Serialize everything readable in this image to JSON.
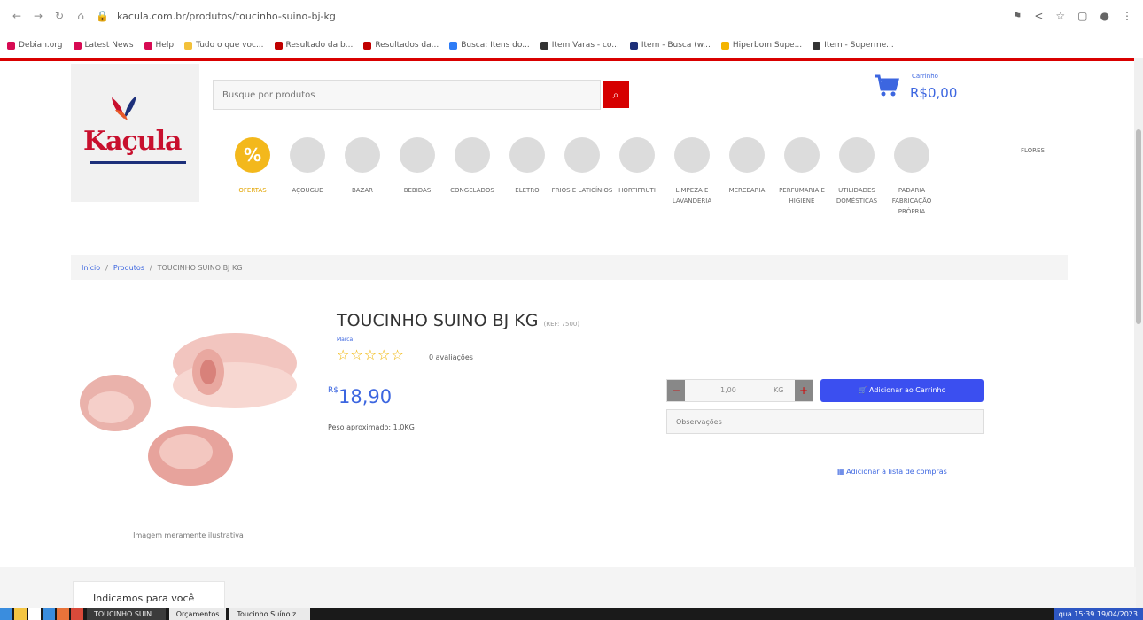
{
  "browser": {
    "url": "kacula.com.br/produtos/toucinho-suino-bj-kg",
    "bookmarks": [
      {
        "label": "Debian.org",
        "color": "#d70a53"
      },
      {
        "label": "Latest News",
        "color": "#d70a53"
      },
      {
        "label": "Help",
        "color": "#d70a53"
      },
      {
        "label": "Tudo o que voc...",
        "color": "#f3c13a"
      },
      {
        "label": "Resultado da b...",
        "color": "#c00000"
      },
      {
        "label": "Resultados da...",
        "color": "#c00000"
      },
      {
        "label": "Busca: Itens do...",
        "color": "#2e7cf6"
      },
      {
        "label": "Item Varas - co...",
        "color": "#333333"
      },
      {
        "label": "Item - Busca (w...",
        "color": "#1d2f78"
      },
      {
        "label": "Hiperbom Supe...",
        "color": "#f4b400"
      },
      {
        "label": "Item - Superme...",
        "color": "#333333"
      }
    ]
  },
  "header": {
    "logo_text": "Kaçula",
    "search_placeholder": "Busque por produtos",
    "cart_label": "Carrinho",
    "cart_value": "R$0,00"
  },
  "categories": [
    {
      "label": "OFERTAS"
    },
    {
      "label": "AÇOUGUE"
    },
    {
      "label": "BAZAR"
    },
    {
      "label": "BEBIDAS"
    },
    {
      "label": "CONGELADOS"
    },
    {
      "label": "ELETRO"
    },
    {
      "label": "FRIOS E LATICÍNIOS"
    },
    {
      "label": "HORTIFRUTI"
    },
    {
      "label": "LIMPEZA E LAVANDERIA"
    },
    {
      "label": "MERCEARIA"
    },
    {
      "label": "PERFUMARIA E HIGIENE"
    },
    {
      "label": "UTILIDADES DOMÉSTICAS"
    },
    {
      "label": "PADARIA FABRICAÇÃO PRÓPRIA"
    }
  ],
  "more_category": "FLORES",
  "breadcrumb": {
    "home": "Início",
    "section": "Produtos",
    "current": "TOUCINHO SUINO BJ KG"
  },
  "product": {
    "title": "TOUCINHO SUINO BJ KG",
    "code": "(REF: 7500)",
    "brand": "Marca",
    "rating": 0,
    "stars_text": "☆☆☆☆☆",
    "reviews": "0 avaliações",
    "currency": "R$",
    "price": "18,90",
    "weight": "Peso aproximado: 1,0KG",
    "image_caption": "Imagem meramente ilustrativa",
    "qty_value": "1,00",
    "qty_unit": "KG",
    "add_to_cart": "Adicionar ao Carrinho",
    "obs_placeholder": "Observações",
    "add_to_list": "Adicionar à lista de compras"
  },
  "section_tab": "Indicamos para você",
  "taskbar": {
    "tasks": [
      "TOUCINHO SUIN...",
      "Orçamentos",
      "Toucinho Suíno z..."
    ],
    "clock": "qua 15:39 19/04/2023"
  }
}
